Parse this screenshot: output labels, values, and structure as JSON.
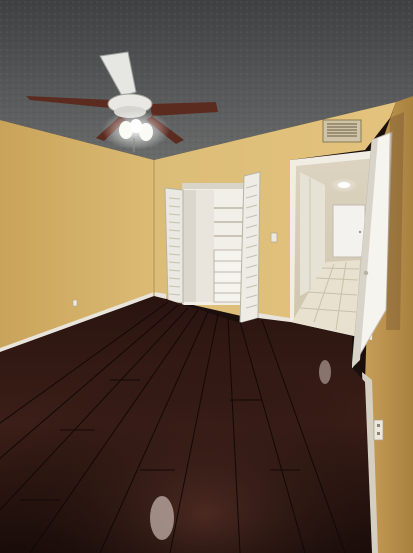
{
  "scene": {
    "kind": "photograph",
    "subject": "empty bedroom",
    "colors": {
      "ceiling": "#5a5c5e",
      "wall": "#d8b66c",
      "wall_shadow": "#b8924d",
      "floor_dark": "#1d0f0c",
      "floor_mid": "#3a1c16",
      "baseboard": "#e8e4dc",
      "closet_door": "#ece9e2",
      "hallway_light": "#e9e0c4",
      "fan_blade": "#5c2b20"
    }
  }
}
